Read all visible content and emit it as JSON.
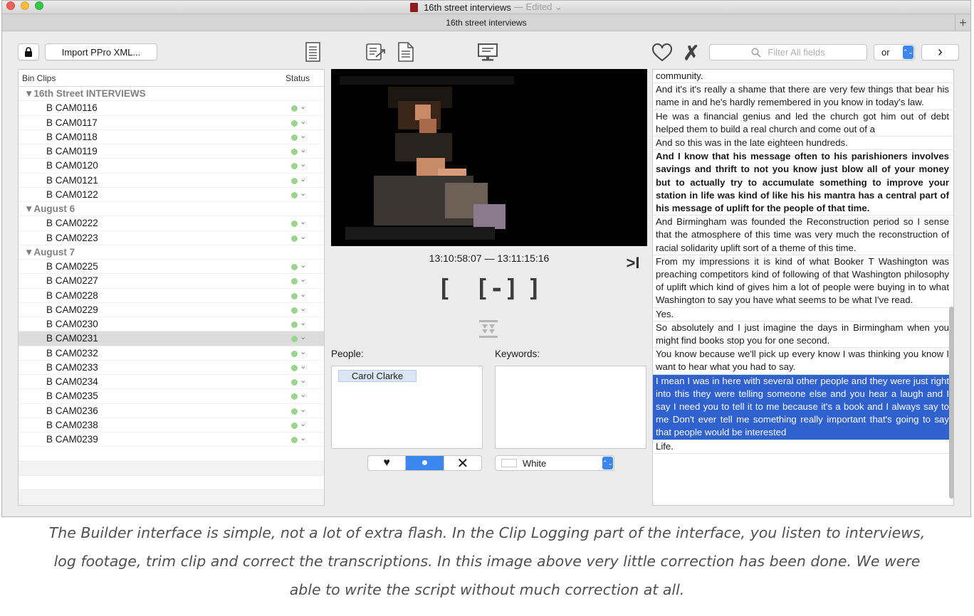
{
  "window": {
    "title": "16th street interviews",
    "edited": "— Edited ⌄",
    "tab_title": "16th street interviews",
    "tab_add": "+"
  },
  "toolbar": {
    "import_label": "Import PPro XML...",
    "search_placeholder": "Filter All fields",
    "or_label": "or",
    "next_label": "›"
  },
  "bin": {
    "header_name": "Bin Clips",
    "header_status": "Status",
    "rows": [
      {
        "type": "group",
        "label": "▼16th Street INTERVIEWS"
      },
      {
        "type": "clip",
        "label": "B CAM0116"
      },
      {
        "type": "clip",
        "label": "B CAM0117"
      },
      {
        "type": "clip",
        "label": "B CAM0118"
      },
      {
        "type": "clip",
        "label": "B CAM0119"
      },
      {
        "type": "clip",
        "label": "B CAM0120"
      },
      {
        "type": "clip",
        "label": "B CAM0121"
      },
      {
        "type": "clip",
        "label": "B CAM0122"
      },
      {
        "type": "group",
        "label": "▼August 6"
      },
      {
        "type": "clip",
        "label": "B CAM0222"
      },
      {
        "type": "clip",
        "label": "B CAM0223"
      },
      {
        "type": "group",
        "label": "▼August 7"
      },
      {
        "type": "clip",
        "label": "B CAM0225"
      },
      {
        "type": "clip",
        "label": "B CAM0227"
      },
      {
        "type": "clip",
        "label": "B CAM0228"
      },
      {
        "type": "clip",
        "label": "B CAM0229"
      },
      {
        "type": "clip",
        "label": "B CAM0230"
      },
      {
        "type": "clip",
        "label": "B CAM0231",
        "selected": true
      },
      {
        "type": "clip",
        "label": "B CAM0232"
      },
      {
        "type": "clip",
        "label": "B CAM0233"
      },
      {
        "type": "clip",
        "label": "B CAM0234"
      },
      {
        "type": "clip",
        "label": "B CAM0235"
      },
      {
        "type": "clip",
        "label": "B CAM0236"
      },
      {
        "type": "clip",
        "label": "B CAM0238"
      },
      {
        "type": "clip",
        "label": "B CAM0239"
      }
    ],
    "status_color": "#9bd48f"
  },
  "player": {
    "timecode": "13:10:58:07 — 13:11:15:16",
    "go_end": ">I",
    "mark_in": "[",
    "mark_clip": "[-]",
    "mark_out": "]"
  },
  "people": {
    "label": "People:",
    "items": [
      "Carol Clarke"
    ]
  },
  "keywords": {
    "label": "Keywords:"
  },
  "rating": {
    "favorite": "♥",
    "neutral": "●",
    "reject": "✕"
  },
  "color_select": {
    "value": "White",
    "stepper": "⌃⌄"
  },
  "transcript": {
    "paragraphs": [
      {
        "text": "community."
      },
      {
        "text": "And it's it's really a shame that there are very few things that bear his name in and he's hardly remembered in you know in today's law."
      },
      {
        "text": "He was a financial genius and led the church got him out of debt helped them to build a real church and come out of a"
      },
      {
        "text": "And so this was in the late eighteen hundreds."
      },
      {
        "text": "And I know that his message often to his parishioners involves savings and thrift to not you know just blow all of your money but to actually try to accumulate something to improve your station in life was kind of like his his mantra has a central part of his message of uplift for the people of that time.",
        "bold": true
      },
      {
        "text": "And Birmingham was founded the Reconstruction period so I sense that the atmosphere of this time was very much the reconstruction of racial solidarity uplift sort of a theme of this time."
      },
      {
        "text": "From my impressions it is kind of what Booker T Washington was preaching competitors kind of following of that Washington philosophy of uplift which kind of gives him a lot of people were buying in to what Washington to say you have what seems to be what I've read."
      },
      {
        "text": "Yes."
      },
      {
        "text": "So absolutely and I just imagine the days in Birmingham when you might find books stop you for one second."
      },
      {
        "text": "You know because we'll pick up every know I was thinking you know I want to hear what you had to say."
      },
      {
        "text": "I mean I was in here with several other people and they were just right into this they were telling someone else and you hear a laugh and I say I need you to tell it to me because it's a book and I always say to me Don't ever tell me something really important that's going to say that people would be interested",
        "selected": true
      },
      {
        "text": "Life."
      }
    ]
  },
  "caption": {
    "line1": "The Builder interface is simple, not a lot of extra flash. In the Clip Logging part of the interface, you listen to interviews,",
    "line2": "log footage, trim clip and correct the transcriptions. In this image above very little correction has been done. We were",
    "line3": "able to write the script without much correction at all."
  },
  "colors": {
    "accent": "#3b86ef",
    "selection": "#2f62cf",
    "tag_bg": "#dbe6f5"
  },
  "icons": {
    "lock": "lock-icon",
    "doc_list": "document-list-icon",
    "export": "export-document-icon",
    "page": "page-icon",
    "monitor": "monitor-icon",
    "heart": "heart-icon",
    "reject": "x-icon",
    "search": "search-icon",
    "merge": "merge-down-icon"
  }
}
